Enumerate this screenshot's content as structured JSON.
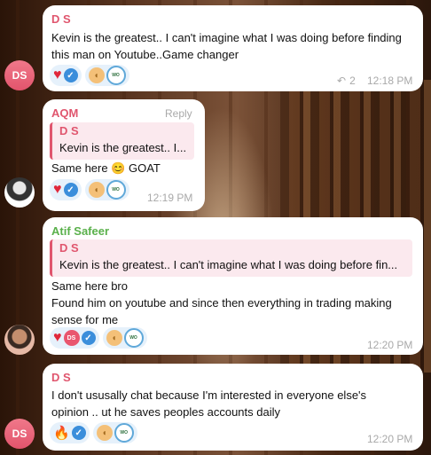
{
  "messages": [
    {
      "sender": "D S",
      "sender_color": "#e0566e",
      "avatar_initials": "DS",
      "text_lines": [
        "Kevin is the greatest.. I can't imagine what I was doing before finding",
        "this man on Youtube..Game changer"
      ],
      "reply_count": "2",
      "time": "12:18 PM"
    },
    {
      "sender": "AQM",
      "sender_color": "#e0566e",
      "reply_label": "Reply",
      "quote": {
        "name": "D S",
        "text": "Kevin is the greatest.. I..."
      },
      "text": "Same here 😊 GOAT",
      "time": "12:19 PM"
    },
    {
      "sender": "Atif Safeer",
      "sender_color": "#5ab04b",
      "quote": {
        "name": "D S",
        "text": "Kevin is the greatest.. I can't imagine what I was doing before fin..."
      },
      "text_lines": [
        "Same here bro",
        "Found him on youtube and since then everything in trading making",
        "sense for me"
      ],
      "reactor_initials": "DS",
      "time": "12:20 PM"
    },
    {
      "sender": "D S",
      "sender_color": "#e0566e",
      "avatar_initials": "DS",
      "text_lines": [
        "I don't ususally chat because I'm interested in everyone else's",
        "opinion .. ut he saves peoples accounts daily"
      ],
      "time": "12:20 PM"
    }
  ],
  "icons": {
    "heart": "heart-icon",
    "check": "verified-check-icon",
    "ears": "ear-emoji-icon",
    "badge": "white-oak-badge-icon",
    "fire": "fire-icon",
    "reply_arrow": "reply-arrow-icon"
  }
}
